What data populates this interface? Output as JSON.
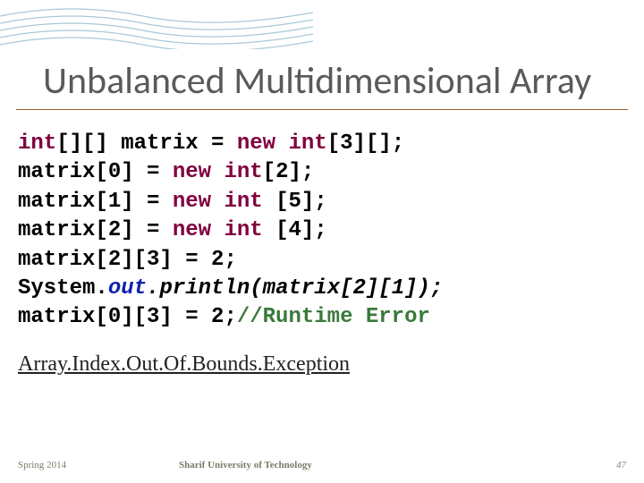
{
  "title": "Unbalanced Multidimensional Array",
  "code": {
    "l1a": "int",
    "l1b": "[][] matrix = ",
    "l1c": "new",
    "l1d": " ",
    "l1e": "int",
    "l1f": "[3][];",
    "l2a": "matrix[0] = ",
    "l2b": "new",
    "l2c": " ",
    "l2d": "int",
    "l2e": "[2];",
    "l3a": "matrix[1] = ",
    "l3b": "new",
    "l3c": " ",
    "l3d": "int",
    "l3e": " [5];",
    "l4a": "matrix[2] = ",
    "l4b": "new",
    "l4c": " ",
    "l4d": "int",
    "l4e": " [4];",
    "l5": "matrix[2][3] = 2;",
    "l6a": "System.",
    "l6b": "out",
    "l6c": ".",
    "l6d": "println",
    "l6e": "(matrix[2][1]);",
    "l7a": "matrix[0][3] = 2;",
    "l7b": "//Runtime Error"
  },
  "exception": "Array.Index.Out.Of.Bounds.Exception",
  "footer": {
    "left": "Spring 2014",
    "center": "Sharif University of Technology",
    "right": "47"
  }
}
